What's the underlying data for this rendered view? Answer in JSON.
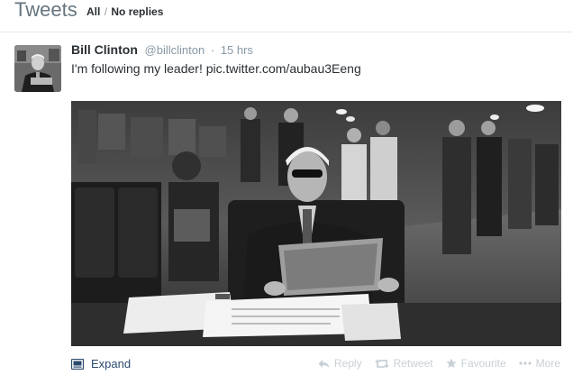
{
  "header": {
    "title": "Tweets",
    "filter_all": "All",
    "filter_separator": "/",
    "filter_no_replies": "No replies"
  },
  "tweet": {
    "fullname": "Bill Clinton",
    "username": "@billclinton",
    "separator": "·",
    "time": "15 hrs",
    "text": "I'm following my leader! ",
    "link": "pic.twitter.com/aubau3Eeng",
    "expand_label": "Expand",
    "actions": {
      "reply": "Reply",
      "retweet": "Retweet",
      "favourite": "Favourite",
      "more": "More"
    }
  },
  "icons": {
    "expand": "expand-icon",
    "reply": "reply-icon",
    "retweet": "retweet-icon",
    "favourite": "star-icon",
    "more": "ellipsis-icon"
  },
  "colors": {
    "header_text": "#66757f",
    "muted": "#8899a6",
    "action_faded": "#c8d0d6",
    "expand_link": "#2b4a6f"
  }
}
